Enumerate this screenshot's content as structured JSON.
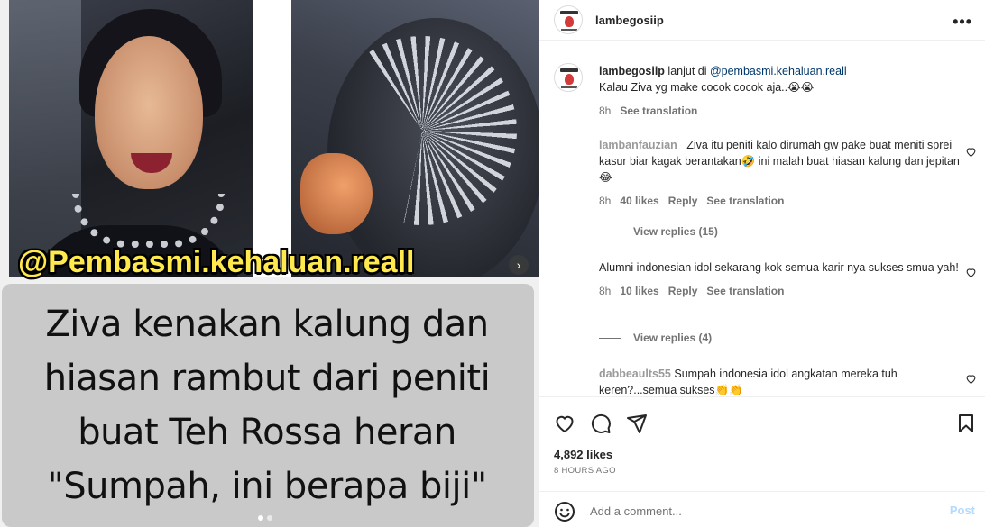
{
  "media": {
    "watermark": "@Pembasmi.kehaluan.reall",
    "headline_lines": [
      "Ziva kenakan kalung dan",
      "hiasan rambut dari peniti",
      "buat Teh Rossa heran",
      "\"Sumpah, ini berapa biji\""
    ],
    "carousel_next_icon": "chevron-right-icon"
  },
  "post": {
    "username": "lambegosiip",
    "more_icon": "•••"
  },
  "caption": {
    "user": "lambegosiip",
    "text_before_mention": " lanjut di ",
    "mention": "@pembasmi.kehaluan.reall",
    "line2": "Kalau Ziva yg make cocok cocok aja..😭😭",
    "time": "8h",
    "see_translation": "See translation"
  },
  "comments": [
    {
      "user": "lambanfauzian_",
      "text": " Ziva itu peniti kalo dirumah gw pake buat meniti sprei kasur biar kagak berantakan🤣 ini malah buat hiasan kalung dan jepitan😂",
      "time": "8h",
      "likes": "40 likes",
      "reply": "Reply",
      "see_translation": "See translation",
      "view_replies": "View replies (15)"
    },
    {
      "user": "",
      "text": "Alumni indonesian idol sekarang kok semua karir nya sukses smua yah!",
      "time": "8h",
      "likes": "10 likes",
      "reply": "Reply",
      "see_translation": "See translation",
      "view_replies": "View replies (4)"
    },
    {
      "user": "dabbeaults55",
      "text": " Sumpah indonesia idol angkatan mereka tuh keren?...semua sukses👏👏"
    }
  ],
  "actions": {
    "likes": "4,892 likes",
    "date": "8 HOURS AGO"
  },
  "add_comment": {
    "placeholder": "Add a comment...",
    "post_label": "Post"
  }
}
